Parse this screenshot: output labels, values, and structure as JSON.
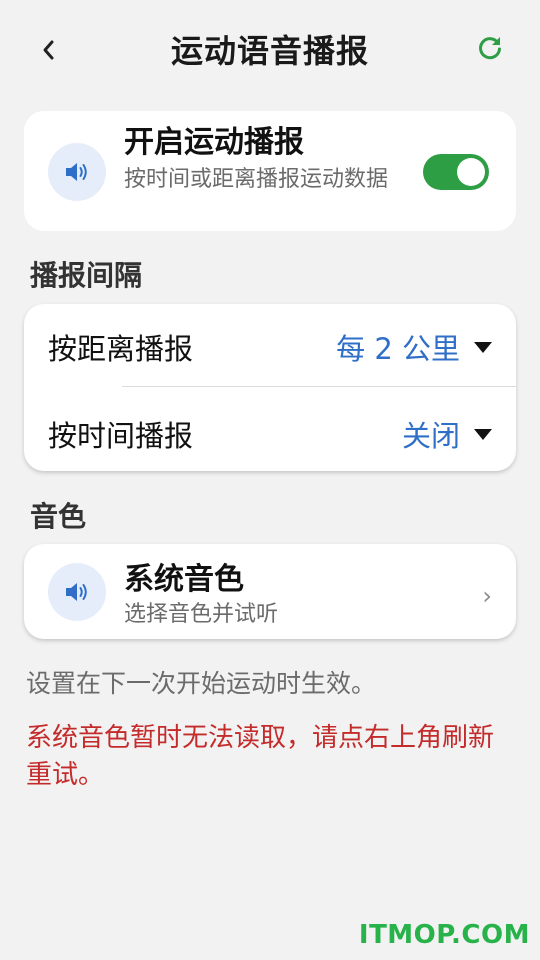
{
  "header": {
    "title": "运动语音播报",
    "back_icon": "chevron-left-icon",
    "refresh_icon": "refresh-icon"
  },
  "broadcast_toggle": {
    "title": "开启运动播报",
    "subtitle": "按时间或距离播报运动数据",
    "enabled": true,
    "icon": "speaker-icon"
  },
  "interval_section": {
    "label": "播报间隔",
    "rows": [
      {
        "label": "按距离播报",
        "value": "每 2 公里"
      },
      {
        "label": "按时间播报",
        "value": "关闭"
      }
    ]
  },
  "voice_section": {
    "label": "音色",
    "voice": {
      "title": "系统音色",
      "subtitle": "选择音色并试听",
      "icon": "speaker-icon"
    }
  },
  "note": "设置在下一次开始运动时生效。",
  "error": "系统音色暂时无法读取，请点右上角刷新重试。",
  "watermark": "ITMOP.COM",
  "colors": {
    "accent_blue": "#2f6fc8",
    "toggle_green": "#2e9e45",
    "error_red": "#c42b2b",
    "watermark_green": "#27b34a"
  }
}
